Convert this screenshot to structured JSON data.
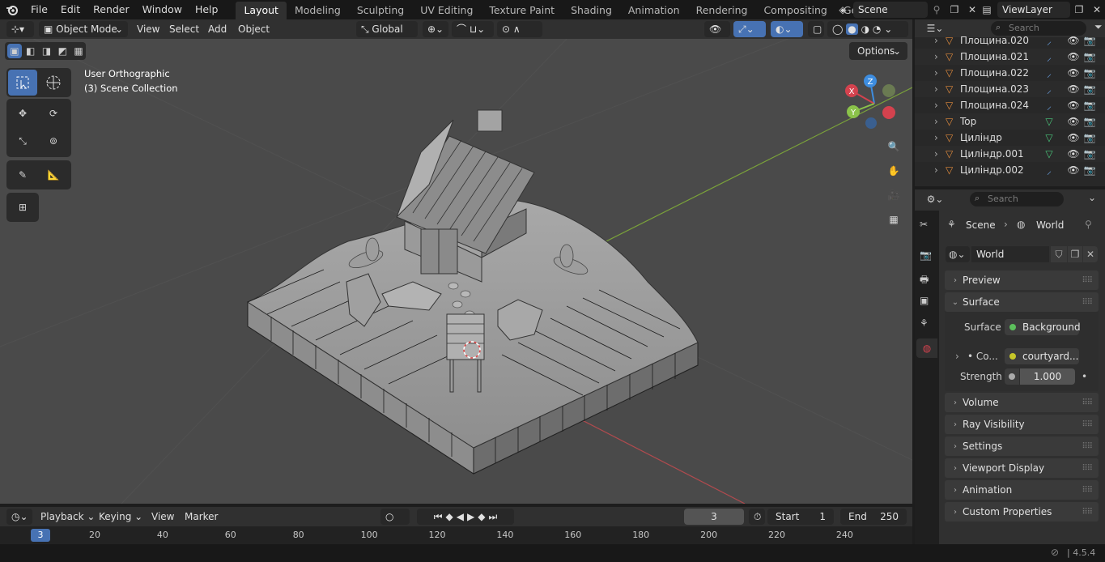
{
  "topbar": {
    "menus": [
      "File",
      "Edit",
      "Render",
      "Window",
      "Help"
    ],
    "workspaces": [
      "Layout",
      "Modeling",
      "Sculpting",
      "UV Editing",
      "Texture Paint",
      "Shading",
      "Animation",
      "Rendering",
      "Compositing",
      "Geometry Node"
    ],
    "active_workspace": "Layout",
    "scene": "Scene",
    "view_layer": "ViewLayer"
  },
  "viewport_header": {
    "mode": "Object Mode",
    "menus": [
      "View",
      "Select",
      "Add",
      "Object"
    ],
    "orientation": "Global",
    "options": "Options"
  },
  "viewport": {
    "view_name": "User Orthographic",
    "collection": "(3) Scene Collection",
    "gizmo_axes": [
      "X",
      "Y",
      "Z"
    ]
  },
  "outliner": {
    "search_placeholder": "Search",
    "items": [
      {
        "name": "Площина.020"
      },
      {
        "name": "Площина.021"
      },
      {
        "name": "Площина.022"
      },
      {
        "name": "Площина.023"
      },
      {
        "name": "Площина.024"
      },
      {
        "name": "Top"
      },
      {
        "name": "Циліндр"
      },
      {
        "name": "Циліндр.001"
      },
      {
        "name": "Циліндр.002"
      }
    ]
  },
  "properties": {
    "search_placeholder": "Search",
    "breadcrumb_scene": "Scene",
    "breadcrumb_world": "World",
    "world_name": "World",
    "panels_top": [
      "Preview",
      "Surface"
    ],
    "surface_label": "Surface",
    "surface_value": "Background",
    "color_label": "Co...",
    "color_value": "courtyard....",
    "strength_label": "Strength",
    "strength_value": "1.000",
    "panels_bottom": [
      "Volume",
      "Ray Visibility",
      "Settings",
      "Viewport Display",
      "Animation",
      "Custom Properties"
    ]
  },
  "timeline": {
    "menus": [
      "Playback",
      "Keying",
      "View",
      "Marker"
    ],
    "current_frame": "3",
    "start_label": "Start",
    "start_value": "1",
    "end_label": "End",
    "end_value": "250",
    "ruler": [
      "20",
      "40",
      "60",
      "80",
      "100",
      "120",
      "140",
      "160",
      "180",
      "200",
      "220",
      "240"
    ],
    "playhead": "3"
  },
  "status": {
    "version": "4.5.4"
  },
  "colors": {
    "accent": "#4772b3",
    "axis_x": "#d4424e",
    "axis_y": "#8bc34a",
    "axis_z": "#3d8de0"
  }
}
